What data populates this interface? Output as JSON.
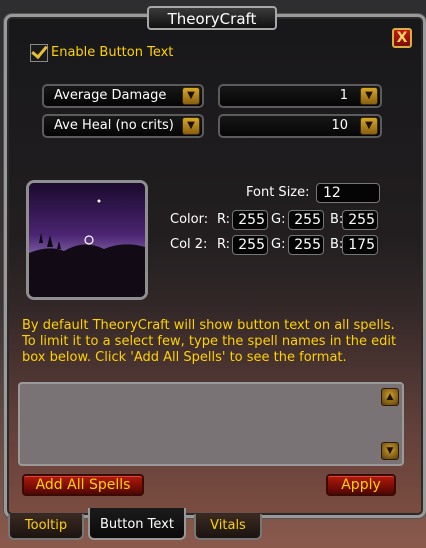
{
  "window": {
    "title": "TheoryCraft",
    "close_label": "X"
  },
  "enable_button_text": {
    "label": "Enable Button Text",
    "checked": true
  },
  "dropdowns": {
    "stat1": "Average Damage",
    "stat2": "Ave Heal (no crits)",
    "value1": "1",
    "value2": "10"
  },
  "font": {
    "label": "Font Size:",
    "value": "12"
  },
  "color1": {
    "label": "Color:",
    "r_label": "R:",
    "g_label": "G:",
    "b_label": "B:",
    "r": "255",
    "g": "255",
    "b": "255"
  },
  "color2": {
    "label": "Col 2:",
    "r_label": "R:",
    "g_label": "G:",
    "b_label": "B:",
    "r": "255",
    "g": "255",
    "b": "175"
  },
  "description": "By default TheoryCraft will show button text on all spells.  To limit it to a select few, type the spell names in the edit box below.  Click 'Add All Spells' to see the format.",
  "spell_list": {
    "value": ""
  },
  "buttons": {
    "add_all": "Add All Spells",
    "apply": "Apply"
  },
  "tabs": [
    {
      "label": "Tooltip",
      "active": false
    },
    {
      "label": "Button Text",
      "active": true
    },
    {
      "label": "Vitals",
      "active": false
    }
  ],
  "colors": {
    "gold_text": "#ffd200",
    "button_red": "#9a1409",
    "preview_sky": "#6a3a8a"
  }
}
